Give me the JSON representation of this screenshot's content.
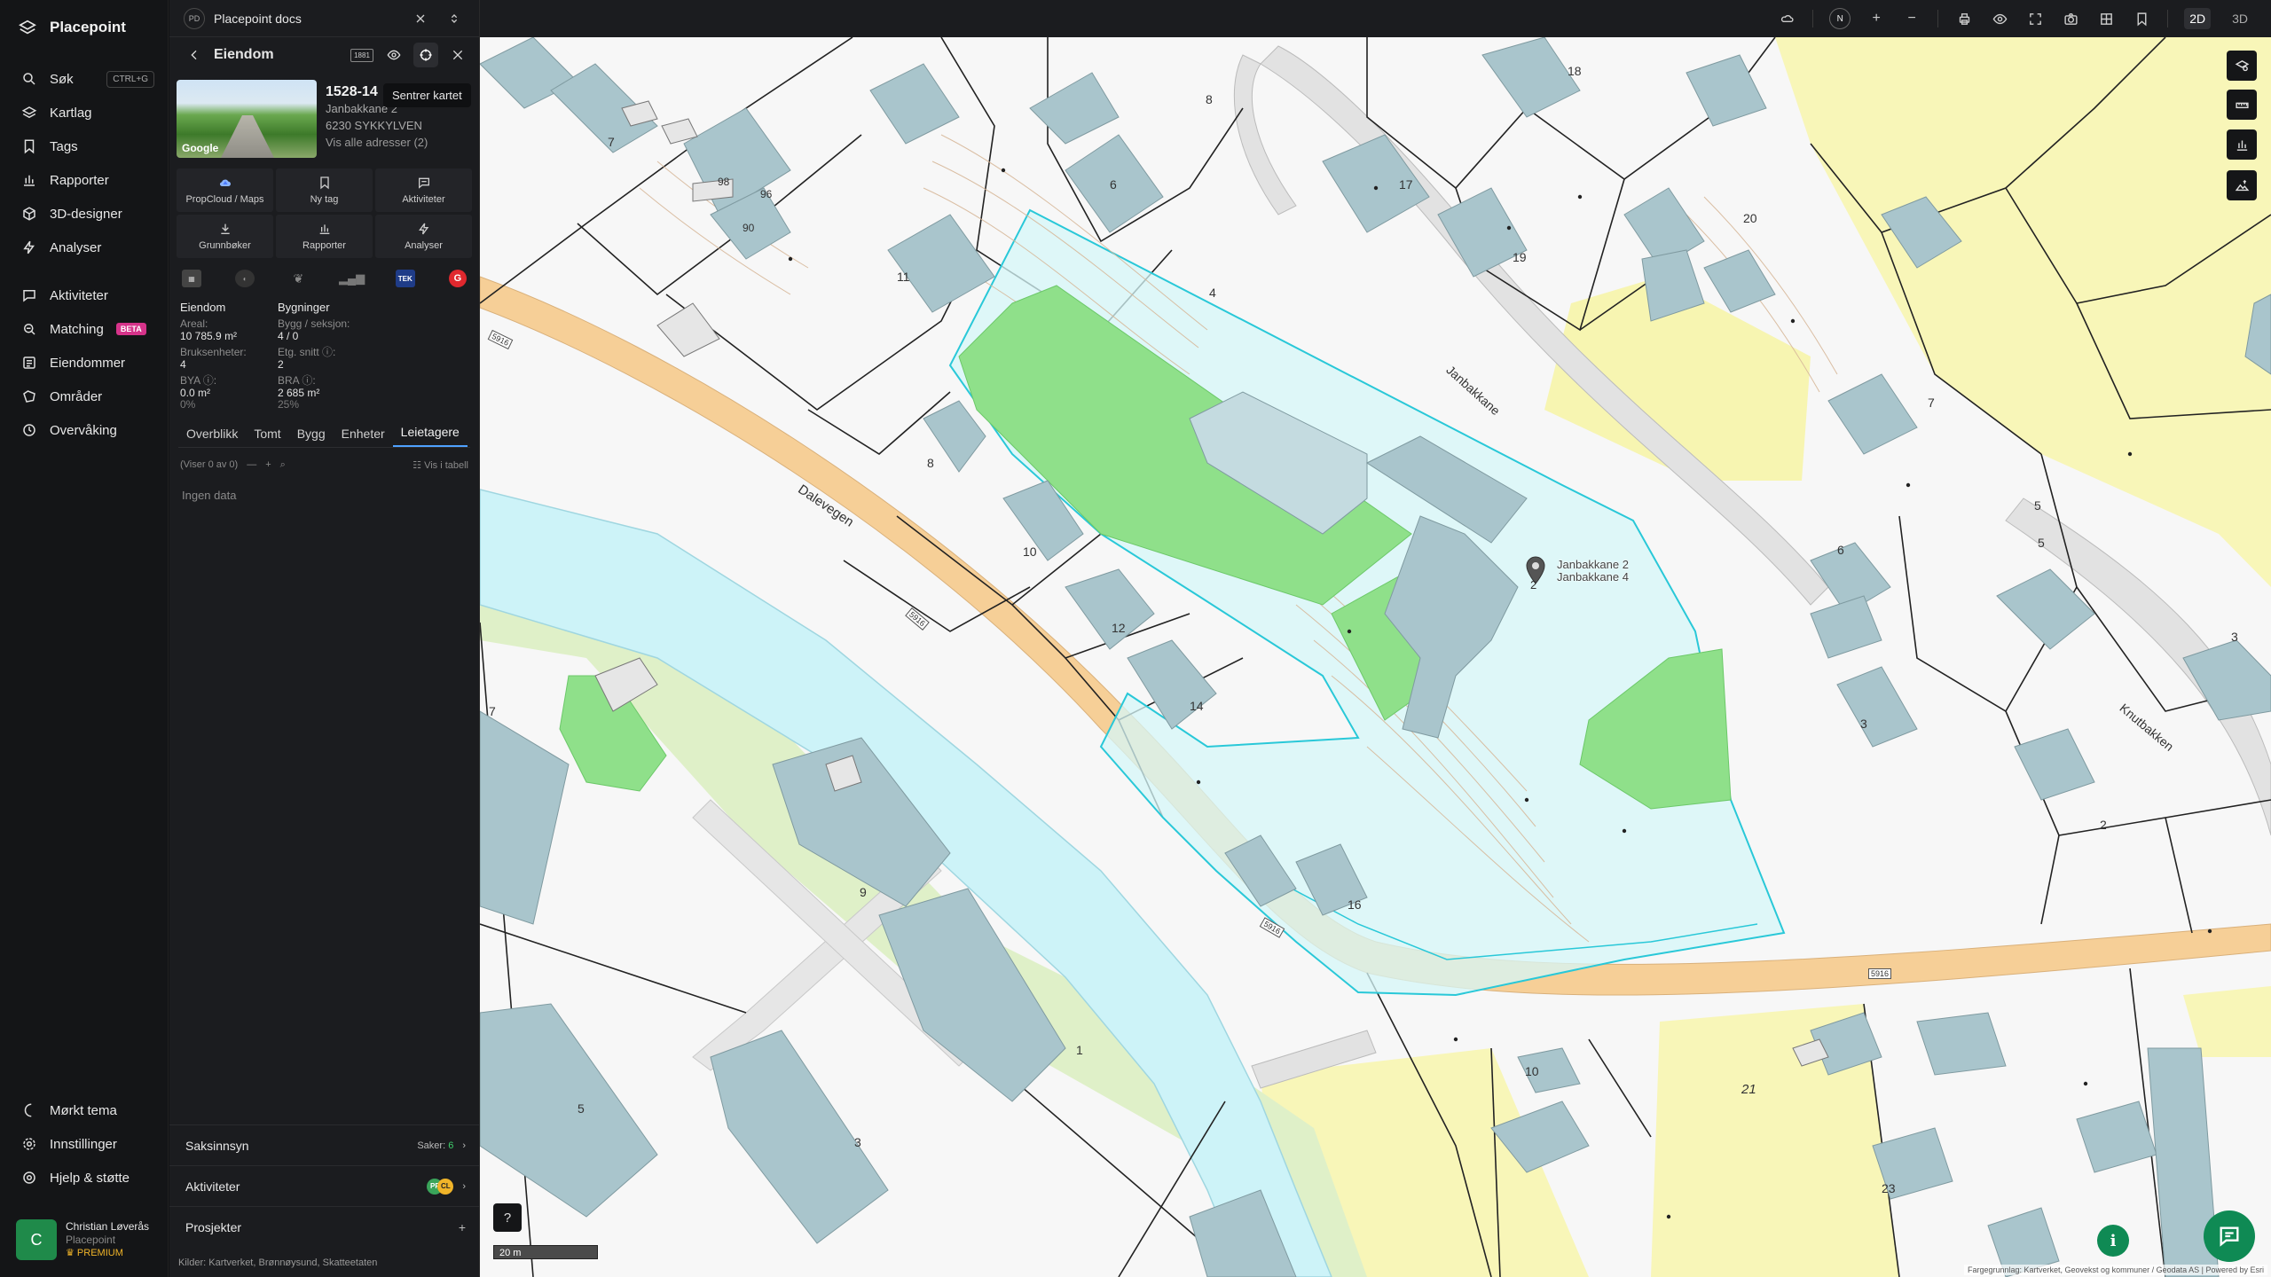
{
  "app": {
    "name": "Placepoint"
  },
  "nav": {
    "items": [
      {
        "label": "Søk",
        "icon": "search-icon",
        "shortcut": "CTRL+G"
      },
      {
        "label": "Kartlag",
        "icon": "layers-icon"
      },
      {
        "label": "Tags",
        "icon": "bookmark-icon"
      },
      {
        "label": "Rapporter",
        "icon": "chart-icon"
      },
      {
        "label": "3D-designer",
        "icon": "cube-icon"
      },
      {
        "label": "Analyser",
        "icon": "bolt-icon"
      },
      {
        "label": "Aktiviteter",
        "icon": "chat-icon"
      },
      {
        "label": "Matching",
        "icon": "match-icon",
        "badge": "BETA"
      },
      {
        "label": "Eiendommer",
        "icon": "list-icon"
      },
      {
        "label": "Områder",
        "icon": "area-icon"
      },
      {
        "label": "Overvåking",
        "icon": "monitor-icon"
      }
    ],
    "bottom": [
      {
        "label": "Mørkt tema",
        "icon": "moon-icon"
      },
      {
        "label": "Innstillinger",
        "icon": "gear-icon"
      },
      {
        "label": "Hjelp & støtte",
        "icon": "help-icon"
      }
    ],
    "user": {
      "initial": "C",
      "name": "Christian Løverås",
      "org": "Placepoint",
      "plan": "PREMIUM"
    }
  },
  "panel": {
    "workspace": {
      "badge": "PD",
      "name": "Placepoint docs"
    },
    "header": {
      "title": "Eiendom",
      "tag": "1881",
      "tooltip": "Sentrer kartet"
    },
    "property": {
      "photo_label": "Google",
      "gnr": "1528-14",
      "address": "Janbakkane 2",
      "postal": "6230 SYKKYLVEN",
      "link": "Vis alle adresser (2)"
    },
    "actions": [
      {
        "label": "PropCloud / Maps",
        "icon": "cloud-icon"
      },
      {
        "label": "Ny tag",
        "icon": "bookmark-icon"
      },
      {
        "label": "Aktiviteter",
        "icon": "chat-icon"
      },
      {
        "label": "Grunnbøker",
        "icon": "download-icon"
      },
      {
        "label": "Rapporter",
        "icon": "chart-icon"
      },
      {
        "label": "Analyser",
        "icon": "bolt-icon"
      }
    ],
    "logos": [
      "TEK",
      "G"
    ],
    "facts": {
      "col1_title": "Eiendom",
      "col2_title": "Bygninger",
      "areal_label": "Areal:",
      "areal_value": "10 785.9",
      "areal_unit": "m²",
      "bygg_label": "Bygg / seksjon:",
      "bygg_value": "4 / 0",
      "bruks_label": "Bruksenheter:",
      "bruks_value": "4",
      "etg_label": "Etg. snitt ⓘ:",
      "etg_value": "2",
      "bya_label": "BYA ⓘ:",
      "bya_value": "0.0",
      "bya_unit": "m²",
      "bya_pct": "0%",
      "bra_label": "BRA ⓘ:",
      "bra_value": "2 685",
      "bra_unit": "m²",
      "bra_pct": "25%"
    },
    "tabs": [
      "Overblikk",
      "Tomt",
      "Bygg",
      "Enheter",
      "Leietagere"
    ],
    "active_tab": 4,
    "table": {
      "showing": "(Viser 0 av 0)",
      "view_label": "Vis i tabell",
      "empty": "Ingen data"
    },
    "sections": {
      "saksinnsyn": "Saksinnsyn",
      "saker_label": "Saker:",
      "saker_count": "6",
      "aktiviteter": "Aktiviteter",
      "prosjekter": "Prosjekter"
    },
    "sources": "Kilder: Kartverket, Brønnøysund, Skatteetaten"
  },
  "map": {
    "modes": [
      "2D",
      "3D"
    ],
    "active_mode": "2D",
    "compass": "N",
    "scale": "20 m",
    "attribution": "Fargegrunnlag: Kartverket, Geovekst og kommuner / Geodata AS | Powered by Esri",
    "marker_label": [
      "Janbakkane 2",
      "Janbakkane 4"
    ],
    "roads": [
      "Dalevegen",
      "Janbakkane",
      "Knutbakken"
    ],
    "road_numbers": [
      "5916",
      "5916",
      "5916",
      "5916"
    ],
    "house_numbers": [
      "18",
      "8",
      "7",
      "17",
      "6",
      "98",
      "96",
      "90",
      "20",
      "19",
      "11",
      "4",
      "8",
      "9",
      "10",
      "7",
      "5",
      "12",
      "14",
      "6",
      "2",
      "3",
      "2",
      "3",
      "10",
      "7",
      "16",
      "9",
      "1",
      "5",
      "3",
      "10",
      "21",
      "23"
    ],
    "colors": {
      "property_fill": "#d6f7f8",
      "property_line": "#29c8d8",
      "road": "#f6cf97",
      "river": "#cdf3f8",
      "building": "#a9c5cc",
      "green": "#8fe08a",
      "yellow": "#f8f6b8"
    }
  }
}
